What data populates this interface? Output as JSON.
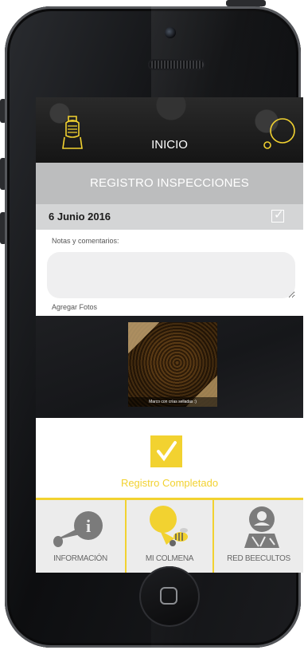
{
  "header": {
    "title": "INICIO"
  },
  "section": {
    "title": "REGISTRO INSPECCIONES"
  },
  "record": {
    "date": "6 Junio 2016"
  },
  "form": {
    "notes_label": "Notas y comentarios:",
    "notes_value": "",
    "photos_label": "Agregar Fotos"
  },
  "photo": {
    "caption": "Marco con crías selladas :)"
  },
  "status": {
    "text": "Registro Completado"
  },
  "tabs": [
    {
      "label": "INFORMACIÓN",
      "icon": "info-icon"
    },
    {
      "label": "MI COLMENA",
      "icon": "bee-icon"
    },
    {
      "label": "RED BEECULTOS",
      "icon": "user-pin-icon"
    }
  ],
  "colors": {
    "accent": "#f2d230",
    "section_bar": "#bcbdbe",
    "date_row": "#d4d5d6"
  }
}
